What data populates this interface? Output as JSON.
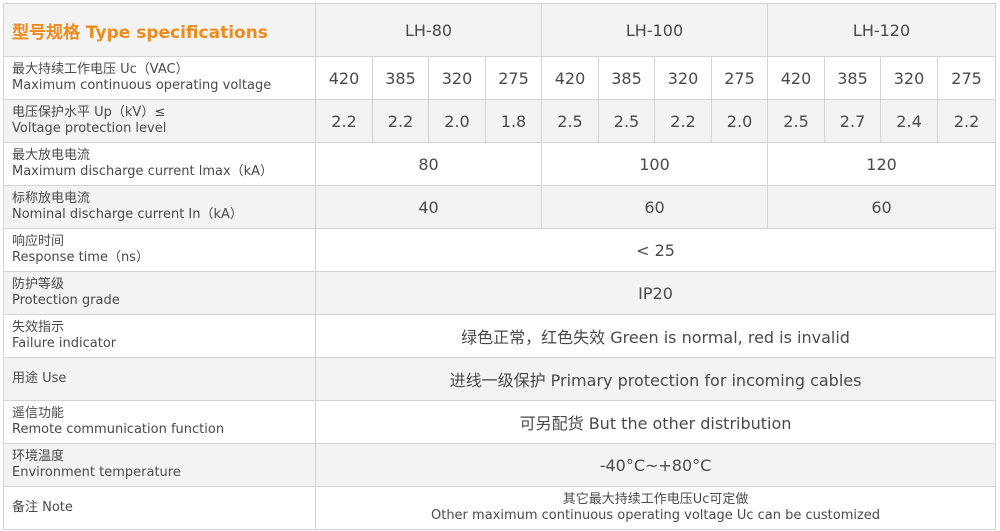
{
  "header": {
    "title": "型号规格 Type specifications",
    "models": [
      "LH-80",
      "LH-100",
      "LH-120"
    ]
  },
  "rows": {
    "uc": {
      "cn": "最大持续工作电压 Uc（VAC）",
      "en": "Maximum continuous operating voltage",
      "values": [
        "420",
        "385",
        "320",
        "275",
        "420",
        "385",
        "320",
        "275",
        "420",
        "385",
        "320",
        "275"
      ]
    },
    "up": {
      "cn": "电压保护水平 Up（kV）≤",
      "en": "Voltage protection level",
      "values": [
        "2.2",
        "2.2",
        "2.0",
        "1.8",
        "2.5",
        "2.5",
        "2.2",
        "2.0",
        "2.5",
        "2.7",
        "2.4",
        "2.2"
      ]
    },
    "imax": {
      "cn": "最大放电电流",
      "en": "Maximum discharge current lmax（kA）",
      "values": [
        "80",
        "100",
        "120"
      ]
    },
    "in": {
      "cn": "标称放电电流",
      "en": "Nominal discharge current In（kA）",
      "values": [
        "40",
        "60",
        "60"
      ]
    },
    "response": {
      "cn": "响应时间",
      "en": "Response time（ns）",
      "value": "< 25"
    },
    "protection": {
      "cn": "防护等级",
      "en": "Protection grade",
      "value": "IP20"
    },
    "failure": {
      "cn": "失效指示",
      "en": "Failure indicator",
      "value": "绿色正常，红色失效 Green is normal, red is invalid"
    },
    "use": {
      "label": "用途 Use",
      "value": "进线一级保护 Primary protection for incoming cables"
    },
    "remote": {
      "cn": "遥信功能",
      "en": "Remote communication function",
      "value": "可另配货 But the other distribution"
    },
    "env": {
      "cn": "环境温度",
      "en": "Environment temperature",
      "value": "-40°C~+80°C"
    },
    "note": {
      "label": "备注 Note",
      "line1": "其它最大持续工作电压Uc可定做",
      "line2": "Other maximum continuous operating voltage Uc can be customized"
    }
  }
}
